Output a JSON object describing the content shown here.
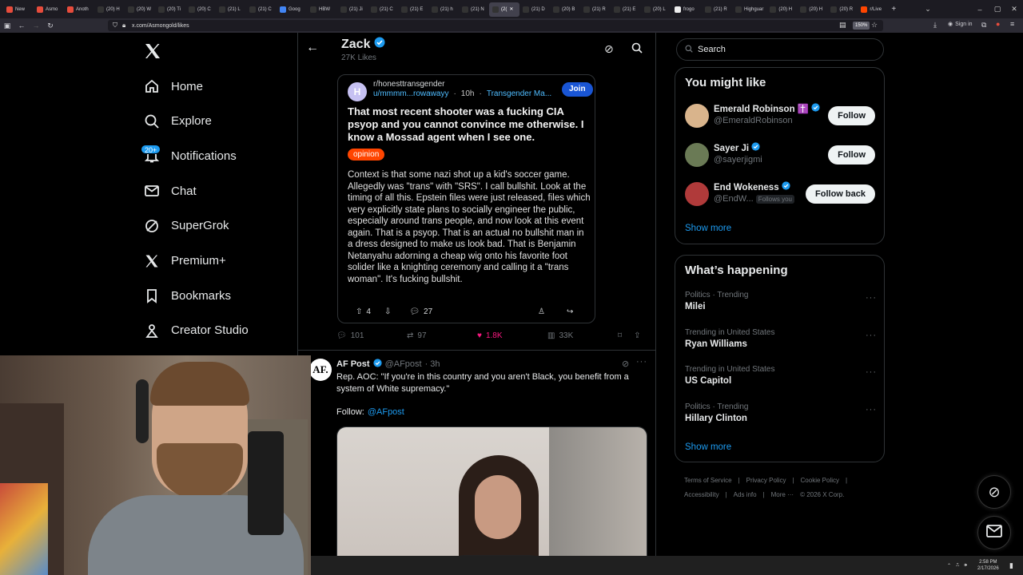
{
  "browser": {
    "tabs": [
      {
        "label": "New",
        "color": "#e74c3c",
        "active": false
      },
      {
        "label": "Asmo",
        "color": "#e74c3c",
        "active": false
      },
      {
        "label": "Anoth",
        "color": "#e74c3c",
        "active": false
      },
      {
        "label": "(20) H",
        "color": "#333333",
        "active": false
      },
      {
        "label": "(20) W",
        "color": "#333333",
        "active": false
      },
      {
        "label": "(20) Ti",
        "color": "#333333",
        "active": false
      },
      {
        "label": "(20) C",
        "color": "#333333",
        "active": false
      },
      {
        "label": "(21) L",
        "color": "#333333",
        "active": false
      },
      {
        "label": "(21) C",
        "color": "#333333",
        "active": false
      },
      {
        "label": "Goog",
        "color": "#4285f4",
        "active": false
      },
      {
        "label": "HBW",
        "color": "#333333",
        "active": false
      },
      {
        "label": "(21) Ji",
        "color": "#333333",
        "active": false
      },
      {
        "label": "(21) C",
        "color": "#333333",
        "active": false
      },
      {
        "label": "(21) E",
        "color": "#333333",
        "active": false
      },
      {
        "label": "(21) h",
        "color": "#333333",
        "active": false
      },
      {
        "label": "(21) N",
        "color": "#333333",
        "active": false
      },
      {
        "label": "(2(",
        "color": "#333333",
        "active": true
      },
      {
        "label": "(21) D",
        "color": "#333333",
        "active": false
      },
      {
        "label": "(20) B",
        "color": "#333333",
        "active": false
      },
      {
        "label": "(21) R",
        "color": "#333333",
        "active": false
      },
      {
        "label": "(21) E",
        "color": "#333333",
        "active": false
      },
      {
        "label": "(20) L",
        "color": "#333333",
        "active": false
      },
      {
        "label": "frogo",
        "color": "#eeeeee",
        "active": false
      },
      {
        "label": "(21) R",
        "color": "#333333",
        "active": false
      },
      {
        "label": "Highguar",
        "color": "#333333",
        "active": false
      },
      {
        "label": "(20) H",
        "color": "#333333",
        "active": false
      },
      {
        "label": "(20) H",
        "color": "#333333",
        "active": false
      },
      {
        "label": "(20) R",
        "color": "#333333",
        "active": false
      },
      {
        "label": "r/Live",
        "color": "#ff4500",
        "active": false
      }
    ],
    "url": "x.com/Asmongold/likes",
    "zoom": "150%",
    "signin": "Sign in"
  },
  "nav": {
    "items": [
      {
        "label": "Home",
        "icon": "home-icon"
      },
      {
        "label": "Explore",
        "icon": "search-icon"
      },
      {
        "label": "Notifications",
        "icon": "bell-icon"
      },
      {
        "label": "Chat",
        "icon": "mail-icon"
      },
      {
        "label": "SuperGrok",
        "icon": "grok-icon"
      },
      {
        "label": "Premium+",
        "icon": "x-logo-icon"
      },
      {
        "label": "Bookmarks",
        "icon": "bookmark-icon"
      },
      {
        "label": "Creator Studio",
        "icon": "creator-studio-icon"
      }
    ],
    "notif_badge": "20+"
  },
  "header": {
    "name": "Zack",
    "likes": "27K Likes"
  },
  "embed": {
    "subreddit": "r/honesttransgender",
    "user": "u/mmmm...rowawayy",
    "age": "10h",
    "tag": "Transgender Ma...",
    "join": "Join",
    "title": "That most recent shooter was a fucking CIA psyop and you cannot convince me otherwise. I know a Mossad agent when I see one.",
    "flair": "opinion",
    "body": "Context is that some nazi shot up a kid's soccer game. Allegedly was \"trans\" with \"SRS\". I call bullshit. Look at the timing of all this. Epstein files were just released, files which very explicitly state plans to socially engineer the public, especially around trans people, and now look at this event again. That is a psyop. That is an actual no bullshit man in a dress designed to make us look bad. That is Benjamin Netanyahu adorning a cheap wig onto his favorite foot solider like a knighting ceremony and calling it a \"trans woman\". It's fucking bullshit.",
    "upvotes": "4",
    "comments": "27"
  },
  "tweet_actions": {
    "replies": "101",
    "reposts": "97",
    "likes": "1.8K",
    "views": "33K"
  },
  "tweet2": {
    "avatar_text": "AF.",
    "name": "AF Post",
    "handle": "@AFpost",
    "time": "· 3h",
    "text": "Rep. AOC: \"If you're in this country and you aren't Black, you benefit from a system of White supremacy.\"",
    "follow_label": "Follow:",
    "follow_link": "@AFpost"
  },
  "right": {
    "search_placeholder": "Search",
    "wtf_title": "You might like",
    "suggestions": [
      {
        "name": "Emerald Robinson ✝️",
        "handle": "@EmeraldRobinson",
        "button": "Follow",
        "follows_you": ""
      },
      {
        "name": "Sayer Ji",
        "handle": "@sayerjigmi",
        "button": "Follow",
        "follows_you": ""
      },
      {
        "name": "End Wokeness",
        "handle": "@EndW...",
        "button": "Follow back",
        "follows_you": "Follows you"
      }
    ],
    "show_more": "Show more",
    "trends_title": "What’s happening",
    "trends": [
      {
        "context": "Politics · Trending",
        "topic": "Milei"
      },
      {
        "context": "Trending in United States",
        "topic": "Ryan Williams"
      },
      {
        "context": "Trending in United States",
        "topic": "US Capitol"
      },
      {
        "context": "Politics · Trending",
        "topic": "Hillary Clinton"
      }
    ],
    "footer1": [
      "Terms of Service",
      "|",
      "Privacy Policy",
      "|",
      "Cookie Policy",
      "|"
    ],
    "footer2": [
      "Accessibility",
      "|",
      "Ads info",
      "|",
      "More ···",
      "© 2026 X Corp."
    ]
  },
  "taskbar": {
    "time": "2:58 PM",
    "date": "2/17/2026"
  },
  "colors": {
    "accent": "#1d9bf0",
    "like": "#f91880",
    "reddit": "#ff4500"
  }
}
